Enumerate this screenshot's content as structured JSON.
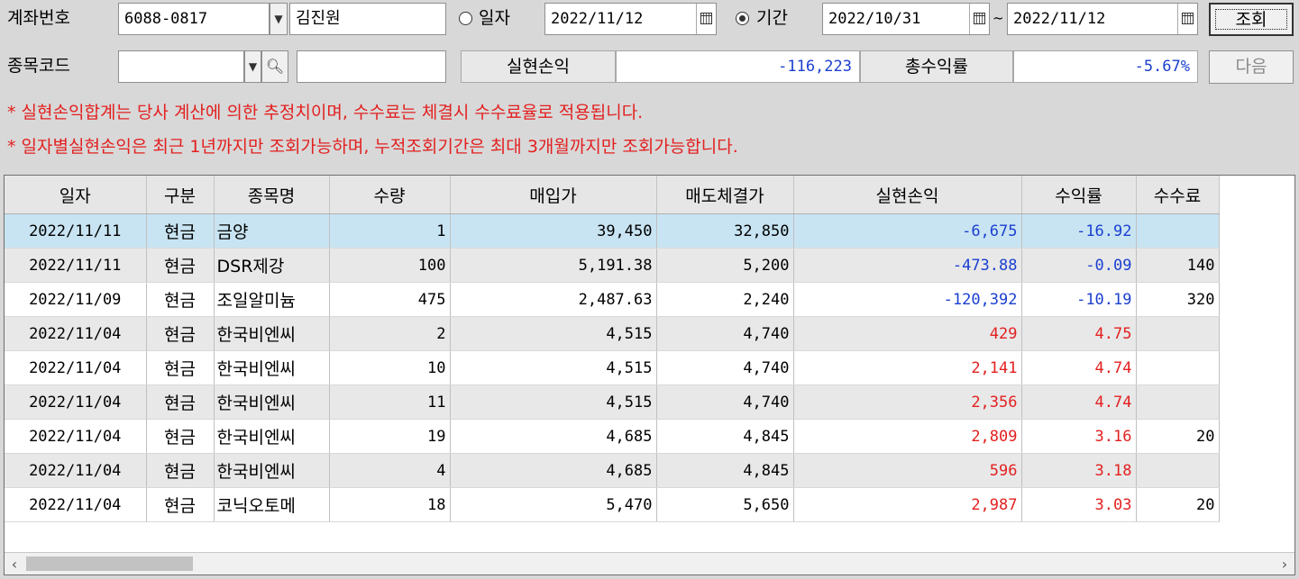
{
  "account": {
    "label": "계좌번호",
    "number": "6088-0817",
    "name": "김진원"
  },
  "search": {
    "mode_date_label": "일자",
    "date": "2022/11/12",
    "mode_period_label": "기간",
    "period_from": "2022/10/31",
    "period_sep": "~",
    "period_to": "2022/11/12",
    "query_button": "조회"
  },
  "stock": {
    "label": "종목코드",
    "code": "",
    "name": ""
  },
  "summary": {
    "realized_label": "실현손익",
    "realized_value": "-116,223",
    "total_return_label": "총수익률",
    "total_return_value": "-5.67%",
    "next_button": "다음"
  },
  "notices": [
    "* 실현손익합계는 당사 계산에 의한 추정치이며, 수수료는 체결시 수수료율로 적용됩니다.",
    "* 일자별실현손익은 최근 1년까지만 조회가능하며, 누적조회기간은 최대 3개월까지만 조회가능합니다."
  ],
  "table": {
    "columns": [
      "일자",
      "구분",
      "종목명",
      "수량",
      "매입가",
      "매도체결가",
      "실현손익",
      "수익률",
      "수수료"
    ],
    "rows": [
      {
        "date": "2022/11/11",
        "type": "현금",
        "name": "금양",
        "qty": "1",
        "buy": "39,450",
        "sell": "32,850",
        "pnl": "-6,675",
        "rate": "-16.92",
        "fee": "",
        "sign": "neg"
      },
      {
        "date": "2022/11/11",
        "type": "현금",
        "name": "DSR제강",
        "qty": "100",
        "buy": "5,191.38",
        "sell": "5,200",
        "pnl": "-473.88",
        "rate": "-0.09",
        "fee": "140",
        "sign": "neg"
      },
      {
        "date": "2022/11/09",
        "type": "현금",
        "name": "조일알미늄",
        "qty": "475",
        "buy": "2,487.63",
        "sell": "2,240",
        "pnl": "-120,392",
        "rate": "-10.19",
        "fee": "320",
        "sign": "neg"
      },
      {
        "date": "2022/11/04",
        "type": "현금",
        "name": "한국비엔씨",
        "qty": "2",
        "buy": "4,515",
        "sell": "4,740",
        "pnl": "429",
        "rate": "4.75",
        "fee": "",
        "sign": "pos"
      },
      {
        "date": "2022/11/04",
        "type": "현금",
        "name": "한국비엔씨",
        "qty": "10",
        "buy": "4,515",
        "sell": "4,740",
        "pnl": "2,141",
        "rate": "4.74",
        "fee": "",
        "sign": "pos"
      },
      {
        "date": "2022/11/04",
        "type": "현금",
        "name": "한국비엔씨",
        "qty": "11",
        "buy": "4,515",
        "sell": "4,740",
        "pnl": "2,356",
        "rate": "4.74",
        "fee": "",
        "sign": "pos"
      },
      {
        "date": "2022/11/04",
        "type": "현금",
        "name": "한국비엔씨",
        "qty": "19",
        "buy": "4,685",
        "sell": "4,845",
        "pnl": "2,809",
        "rate": "3.16",
        "fee": "20",
        "sign": "pos"
      },
      {
        "date": "2022/11/04",
        "type": "현금",
        "name": "한국비엔씨",
        "qty": "4",
        "buy": "4,685",
        "sell": "4,845",
        "pnl": "596",
        "rate": "3.18",
        "fee": "",
        "sign": "pos"
      },
      {
        "date": "2022/11/04",
        "type": "현금",
        "name": "코닉오토메",
        "qty": "18",
        "buy": "5,470",
        "sell": "5,650",
        "pnl": "2,987",
        "rate": "3.03",
        "fee": "20",
        "sign": "pos"
      }
    ]
  },
  "colors": {
    "negative": "#1a3fd0",
    "positive": "#e32020",
    "selected_row": "#c8e4f2",
    "alt_row": "#e8e8e8"
  }
}
